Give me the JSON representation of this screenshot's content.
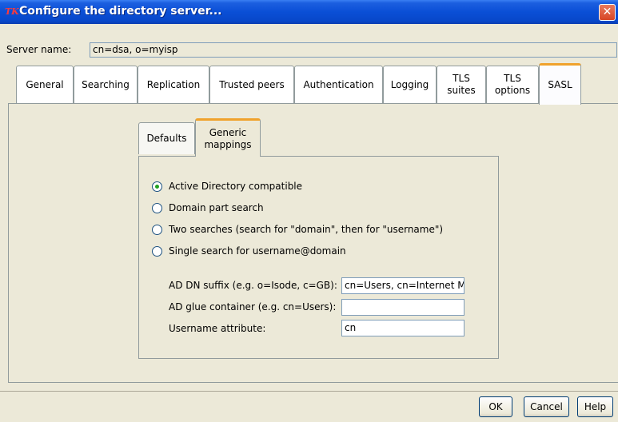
{
  "window": {
    "title": "Configure the directory server...",
    "app_icon": "TK",
    "close_glyph": "✕"
  },
  "server": {
    "label": "Server name:",
    "value": "cn=dsa, o=myisp"
  },
  "tabs": [
    {
      "label": "General"
    },
    {
      "label": "Searching"
    },
    {
      "label": "Replication"
    },
    {
      "label": "Trusted peers"
    },
    {
      "label": "Authentication"
    },
    {
      "label": "Logging"
    },
    {
      "label": "TLS\nsuites"
    },
    {
      "label": "TLS\noptions"
    },
    {
      "label": "SASL"
    }
  ],
  "selected_tab": "SASL",
  "subtabs": [
    {
      "label": "Defaults"
    },
    {
      "label": "Generic\nmappings"
    }
  ],
  "selected_subtab": "Generic mappings",
  "radios": [
    {
      "label": "Active Directory compatible",
      "checked": true
    },
    {
      "label": "Domain part search",
      "checked": false
    },
    {
      "label": "Two searches  (search for \"domain\", then for \"username\")",
      "checked": false
    },
    {
      "label": "Single search for username@domain",
      "checked": false
    }
  ],
  "fields": [
    {
      "label": "AD DN suffix (e.g. o=Isode, c=GB):",
      "value": "cn=Users, cn=Internet M"
    },
    {
      "label": "AD glue container (e.g. cn=Users):",
      "value": ""
    },
    {
      "label": "Username attribute:",
      "value": "cn"
    }
  ],
  "buttons": {
    "ok": "OK",
    "cancel": "Cancel",
    "help": "Help"
  },
  "colors": {
    "titlebar": "#0a4fd6",
    "selected_tab_accent": "#f0a22c",
    "radio_dot": "#21a121"
  }
}
